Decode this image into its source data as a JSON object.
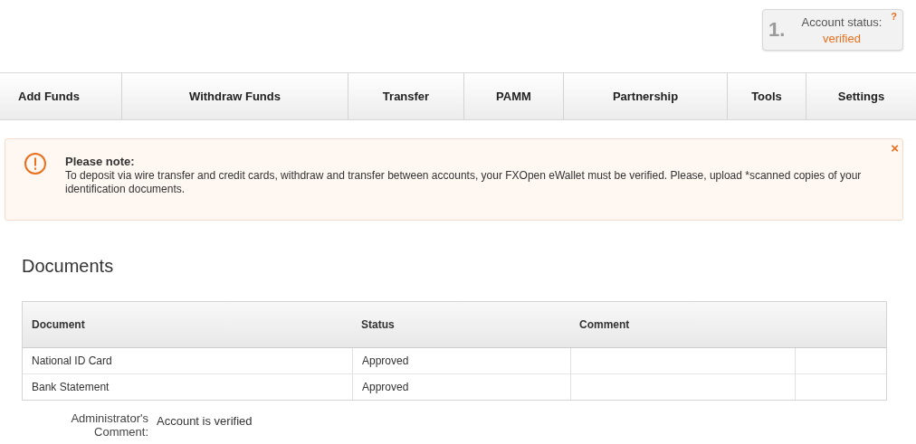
{
  "account_status": {
    "step": "1.",
    "label": "Account status:",
    "value": "verified",
    "help": "?"
  },
  "nav": [
    {
      "label": "Add Funds",
      "selected": false
    },
    {
      "label": "Withdraw Funds",
      "selected": false
    },
    {
      "label": "Transfer",
      "selected": false
    },
    {
      "label": "PAMM",
      "selected": false
    },
    {
      "label": "Partnership",
      "selected": false
    },
    {
      "label": "Tools",
      "selected": false
    },
    {
      "label": "Settings",
      "selected": false
    }
  ],
  "notice": {
    "title": "Please note:",
    "text": "To deposit via wire transfer and credit cards, withdraw and transfer between accounts, your FXOpen eWallet must be verified. Please, upload *scanned copies of your identification documents.",
    "close": "×"
  },
  "documents": {
    "title": "Documents",
    "columns": [
      "Document",
      "Status",
      "Comment"
    ],
    "rows": [
      {
        "document": "National ID Card",
        "status": "Approved"
      },
      {
        "document": "Bank Statement",
        "status": "Approved"
      }
    ]
  },
  "admin_comment": {
    "label": "Administrator's Comment:",
    "value": "Account is verified"
  }
}
